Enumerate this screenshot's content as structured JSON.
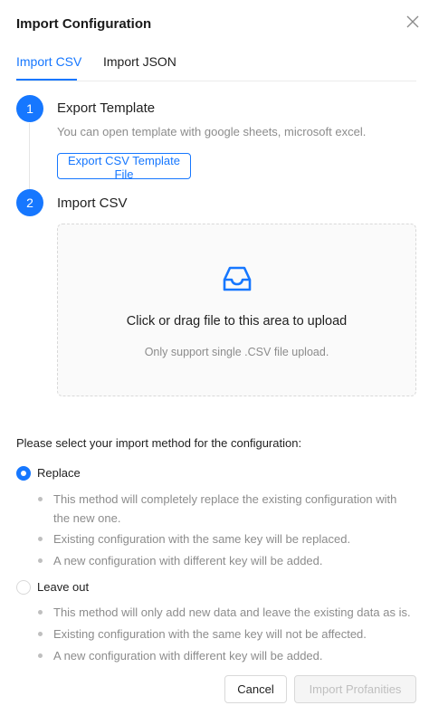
{
  "dialog": {
    "title": "Import Configuration"
  },
  "tabs": [
    {
      "label": "Import CSV",
      "active": true
    },
    {
      "label": "Import JSON",
      "active": false
    }
  ],
  "steps": [
    {
      "number": "1",
      "title": "Export Template",
      "description": "You can open template with google sheets, microsoft excel.",
      "button_label": "Export CSV Template File"
    },
    {
      "number": "2",
      "title": "Import CSV"
    }
  ],
  "upload": {
    "text": "Click or drag file to this area to upload",
    "hint": "Only support single .CSV file upload.",
    "icon": "inbox-icon"
  },
  "method": {
    "prompt": "Please select your import method for the configuration:",
    "options": [
      {
        "label": "Replace",
        "selected": true,
        "bullets": [
          "This method will completely replace the existing configuration with the new one.",
          "Existing configuration with the same key will be replaced.",
          "A new configuration with different key will be added."
        ]
      },
      {
        "label": "Leave out",
        "selected": false,
        "bullets": [
          "This method will only add new data and leave the existing data as is.",
          "Existing configuration with the same key will not be affected.",
          "A new configuration with different key will be added."
        ]
      }
    ]
  },
  "footer": {
    "cancel_label": "Cancel",
    "import_label": "Import Profanities",
    "import_disabled": true
  },
  "colors": {
    "accent": "#1677ff",
    "muted_text": "#8c8c8c",
    "border": "#d9d9d9"
  }
}
